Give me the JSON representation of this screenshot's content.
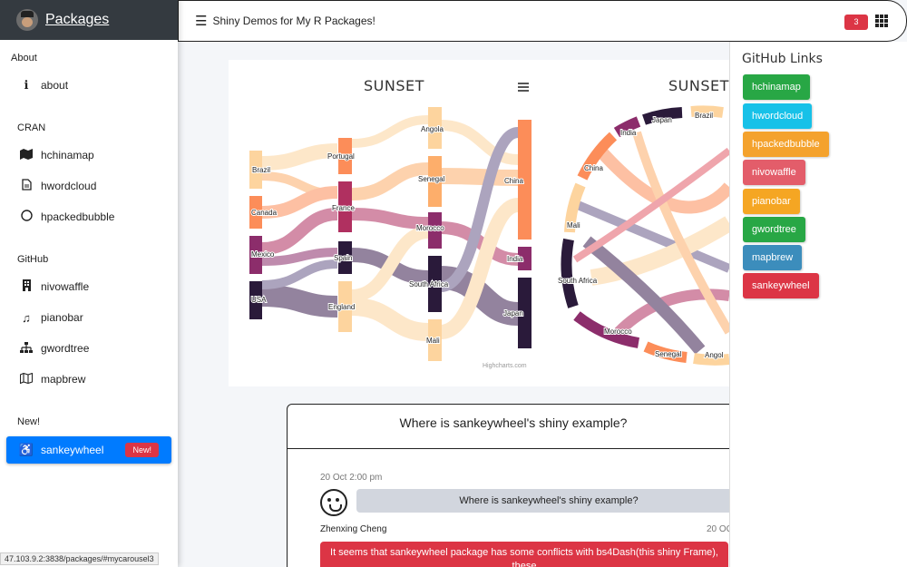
{
  "brand": {
    "title": "Packages"
  },
  "topbar": {
    "title": "Shiny Demos for My R Packages!",
    "notifications": "3"
  },
  "sidebar": {
    "sections": [
      "About",
      "CRAN",
      "GitHub",
      "New!"
    ],
    "items": [
      {
        "label": "about",
        "icon": "info-icon"
      },
      {
        "label": "hchinamap",
        "icon": "map-icon"
      },
      {
        "label": "hwordcloud",
        "icon": "file-icon"
      },
      {
        "label": "hpackedbubble",
        "icon": "circle-icon"
      },
      {
        "label": "nivowaffle",
        "icon": "building-icon"
      },
      {
        "label": "pianobar",
        "icon": "music-icon"
      },
      {
        "label": "gwordtree",
        "icon": "sitemap-icon"
      },
      {
        "label": "mapbrew",
        "icon": "map-outline-icon"
      },
      {
        "label": "sankeywheel",
        "icon": "wheelchair-icon",
        "badge": "New!"
      }
    ]
  },
  "carousel": {
    "left_title": "SUNSET",
    "right_title": "SUNSET",
    "credit": "Highcharts.com",
    "sankey_nodes": [
      "Brazil",
      "Canada",
      "Mexico",
      "USA",
      "Portugal",
      "France",
      "Spain",
      "England",
      "Angola",
      "Senegal",
      "Morocco",
      "South Africa",
      "Mali",
      "China",
      "India",
      "Japan"
    ],
    "wheel_nodes": [
      "Japan",
      "Brazil",
      "India",
      "China",
      "Mali",
      "South Africa",
      "Morocco",
      "Senegal",
      "Angol"
    ]
  },
  "chat": {
    "title": "Where is sankeywheel's shiny example?",
    "time1": "20 Oct 2:00 pm",
    "question": "Where is sankeywheel's shiny example?",
    "author": "Zhenxing Cheng",
    "time2": "20 OC",
    "answer": "It seems that sankeywheel package has some conflicts with bs4Dash(this shiny Frame), these"
  },
  "control": {
    "title": "GitHub Links",
    "links": [
      {
        "label": "hchinamap",
        "color": "#28a745"
      },
      {
        "label": "hwordcloud",
        "color": "#17c1e8"
      },
      {
        "label": "hpackedbubble",
        "color": "#f4a22d"
      },
      {
        "label": "nivowaffle",
        "color": "#e35d6a"
      },
      {
        "label": "pianobar",
        "color": "#f5a623"
      },
      {
        "label": "gwordtree",
        "color": "#28a745"
      },
      {
        "label": "mapbrew",
        "color": "#3c8dbc"
      },
      {
        "label": "sankeywheel",
        "color": "#dc3545"
      }
    ]
  },
  "status": "47.103.9.2:3838/packages/#mycarousel3"
}
